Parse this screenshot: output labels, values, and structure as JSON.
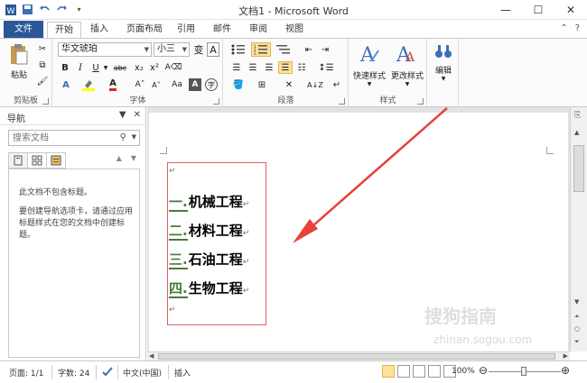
{
  "window": {
    "title": "文档1 - Microsoft Word"
  },
  "tabs": {
    "file": "文件",
    "items": [
      "开始",
      "插入",
      "页面布局",
      "引用",
      "邮件",
      "审阅",
      "视图"
    ]
  },
  "ribbon": {
    "clipboard": {
      "paste": "粘贴",
      "label": "剪贴板"
    },
    "font": {
      "name": "华文琥珀",
      "size": "小三",
      "label": "字体",
      "bold": "B",
      "italic": "I",
      "underline": "U",
      "strike": "abc",
      "subscript": "x₂",
      "superscript": "x²",
      "font_color": "A",
      "grow": "A˄",
      "shrink": "A˅",
      "case": "Aa"
    },
    "paragraph": {
      "label": "段落"
    },
    "styles": {
      "quick_styles": "快速样式",
      "change_styles": "更改样式",
      "label": "样式"
    },
    "editing": {
      "label": "编辑"
    }
  },
  "nav": {
    "title": "导航",
    "search_placeholder": "搜索文档",
    "message1": "此文档不包含标题。",
    "message2": "要创建导航选项卡，请通过应用标题样式在您的文档中创建标题。"
  },
  "document": {
    "headings": [
      {
        "num": "一.",
        "text": "机械工程"
      },
      {
        "num": "二.",
        "text": "材料工程"
      },
      {
        "num": "三.",
        "text": "石油工程"
      },
      {
        "num": "四.",
        "text": "生物工程"
      }
    ]
  },
  "status": {
    "page": "页面: 1/1",
    "words": "字数: 24",
    "language": "中文(中国)",
    "mode": "插入",
    "zoom": "100%"
  },
  "colors": {
    "file_tab": "#2b5797",
    "arrow": "#e8403a",
    "heading_box": "#e06060",
    "numbering": "#4a7a3a"
  },
  "watermark": {
    "text": "搜狗指南",
    "url": "zhinan.sogou.com"
  }
}
